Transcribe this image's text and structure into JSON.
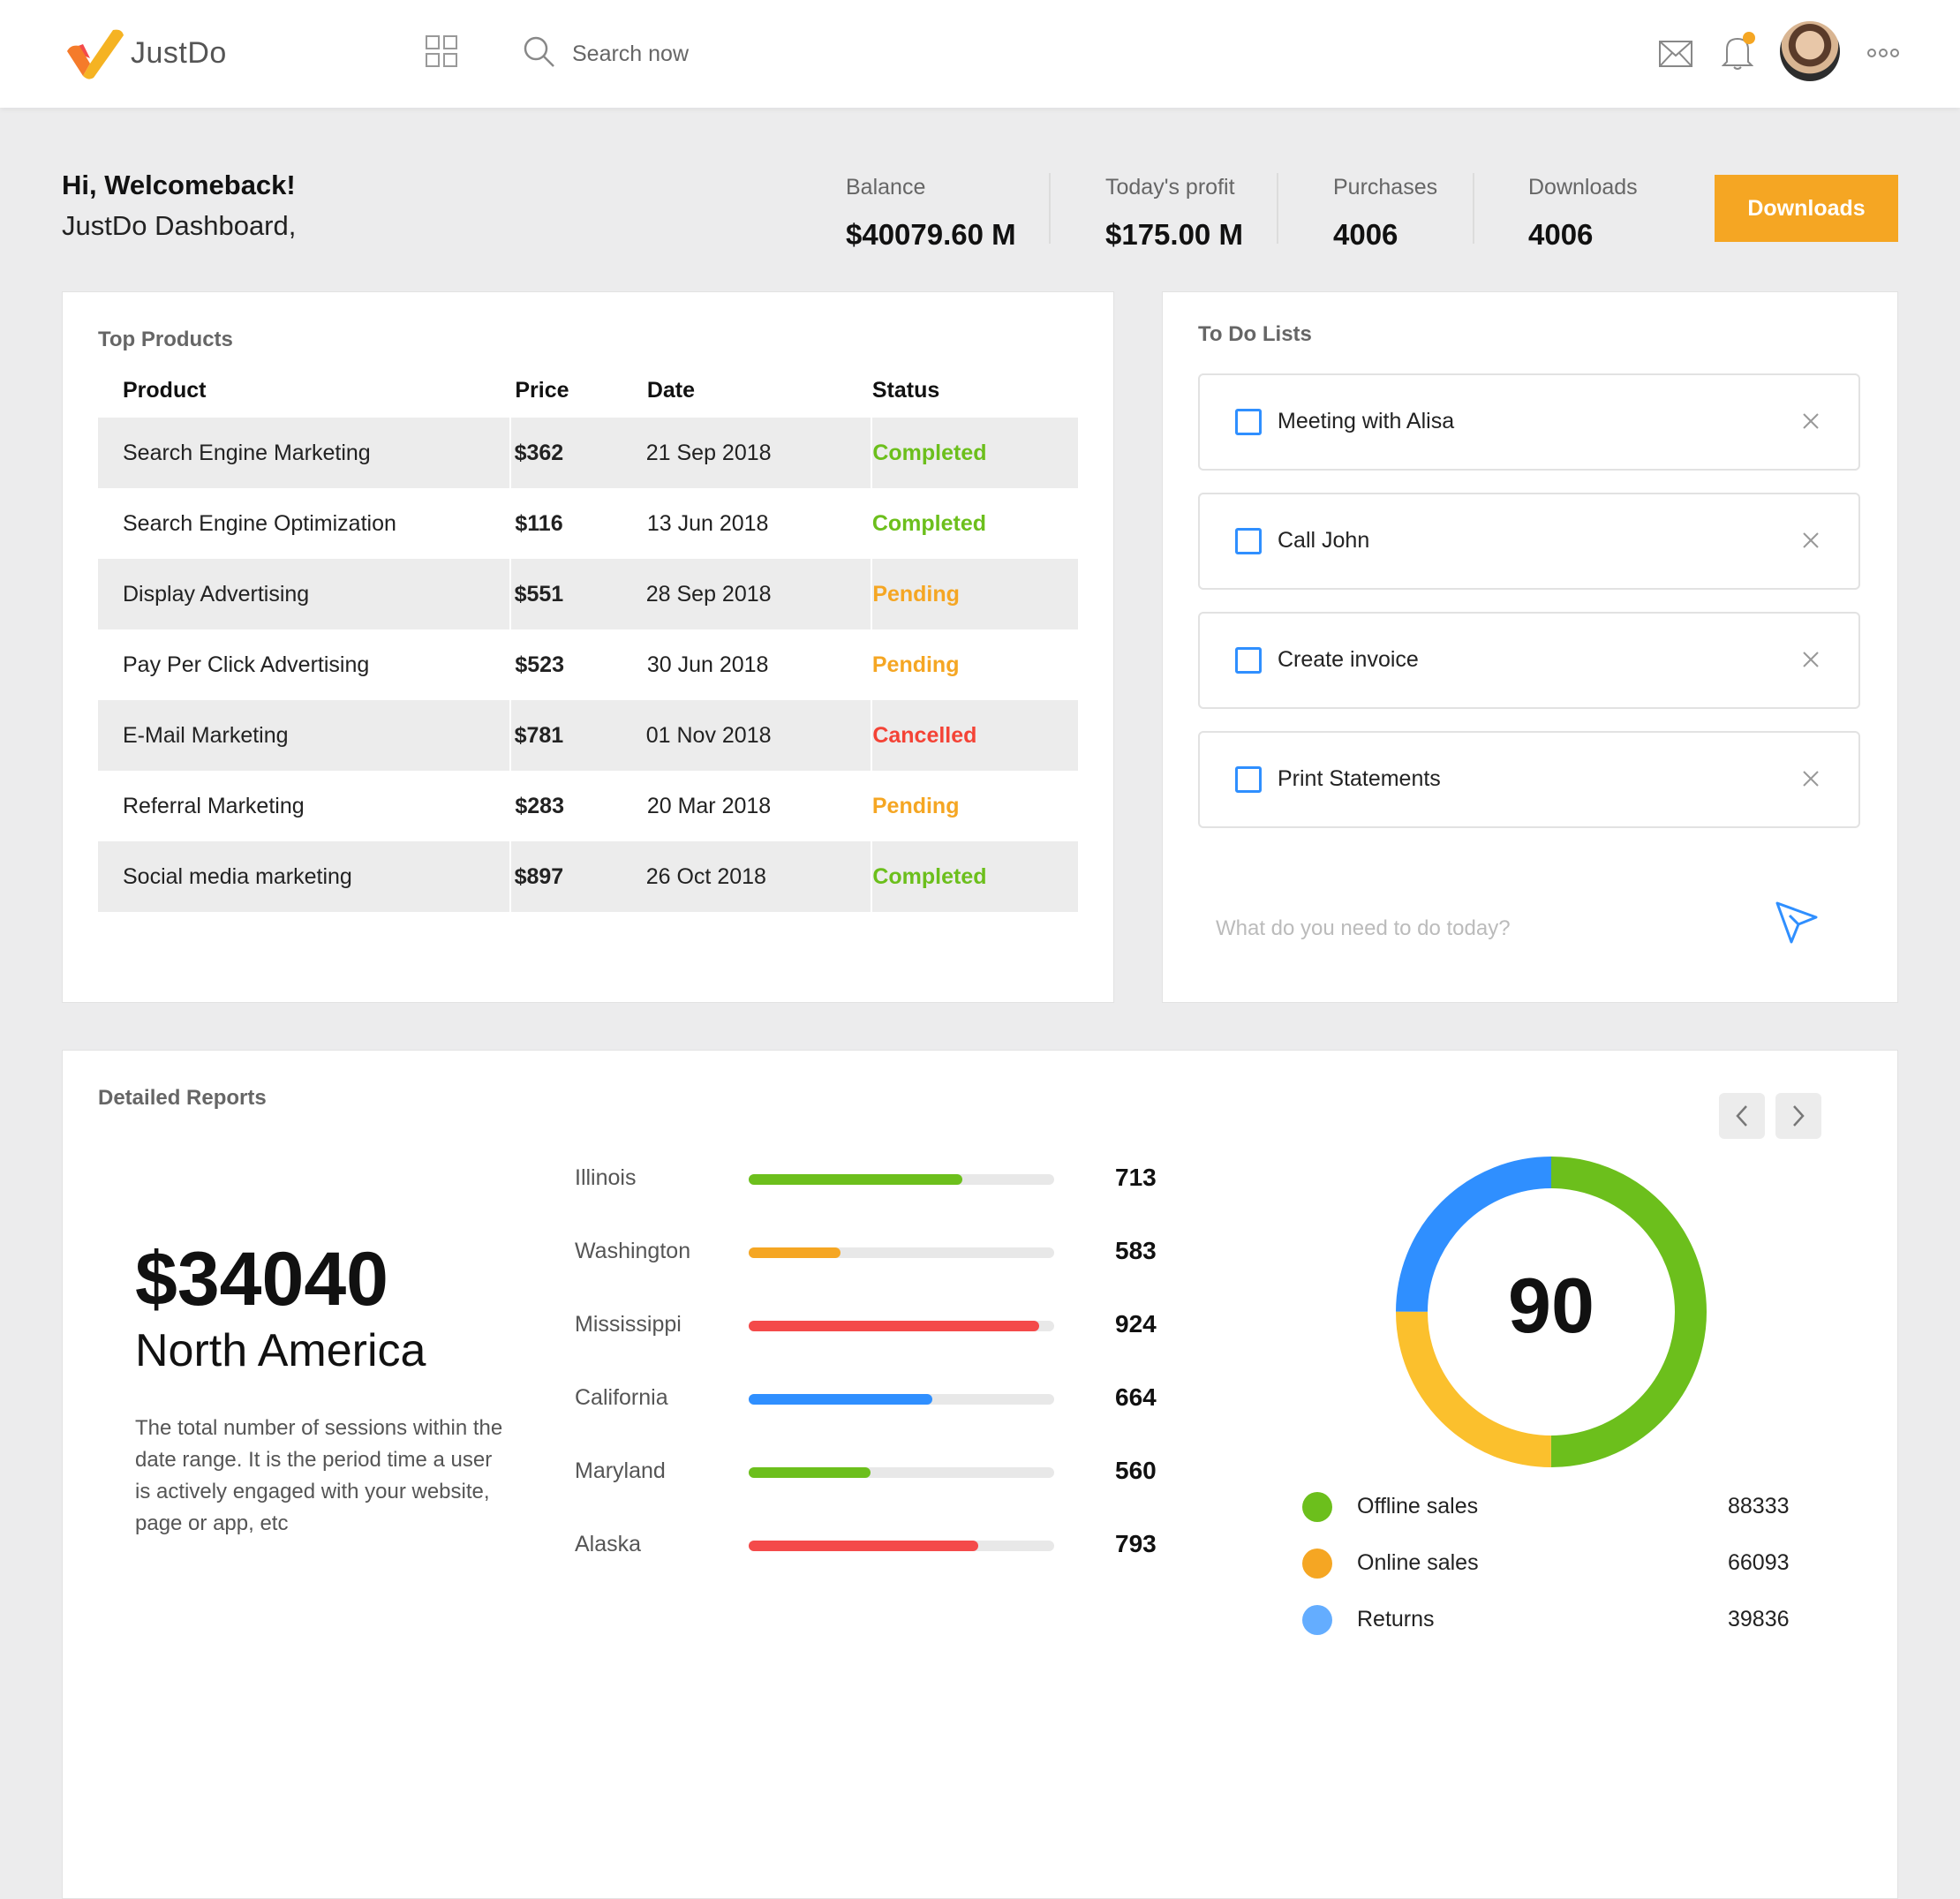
{
  "app": {
    "name": "JustDo"
  },
  "search": {
    "placeholder": "Search now"
  },
  "welcome": {
    "greeting": "Hi, Welcomeback!",
    "subtitle": "JustDo Dashboard,"
  },
  "stats": [
    {
      "label": "Balance",
      "value": "$40079.60 M"
    },
    {
      "label": "Today's profit",
      "value": "$175.00 M"
    },
    {
      "label": "Purchases",
      "value": "4006"
    },
    {
      "label": "Downloads",
      "value": "4006"
    }
  ],
  "downloads_button": {
    "label": "Downloads",
    "color": "#f5a623"
  },
  "top_products": {
    "title": "Top Products",
    "columns": [
      "Product",
      "Price",
      "Date",
      "Status"
    ],
    "rows": [
      {
        "product": "Search Engine Marketing",
        "price": "$362",
        "date": "21 Sep 2018",
        "status": "Completed"
      },
      {
        "product": "Search Engine Optimization",
        "price": "$116",
        "date": "13 Jun 2018",
        "status": "Completed"
      },
      {
        "product": "Display Advertising",
        "price": "$551",
        "date": "28 Sep 2018",
        "status": "Pending"
      },
      {
        "product": "Pay Per Click Advertising",
        "price": "$523",
        "date": "30 Jun 2018",
        "status": "Pending"
      },
      {
        "product": "E-Mail Marketing",
        "price": "$781",
        "date": "01 Nov 2018",
        "status": "Cancelled"
      },
      {
        "product": "Referral Marketing",
        "price": "$283",
        "date": "20 Mar 2018",
        "status": "Pending"
      },
      {
        "product": "Social media marketing",
        "price": "$897",
        "date": "26 Oct 2018",
        "status": "Completed"
      }
    ],
    "status_colors": {
      "Completed": "#6cbf1c",
      "Pending": "#f5a623",
      "Cancelled": "#f44336"
    }
  },
  "todo": {
    "title": "To Do Lists",
    "items": [
      {
        "label": "Meeting with Alisa",
        "checked": false
      },
      {
        "label": "Call John",
        "checked": false
      },
      {
        "label": "Create invoice",
        "checked": false
      },
      {
        "label": "Print Statements",
        "checked": false
      }
    ],
    "input_placeholder": "What do you need to do today?"
  },
  "reports": {
    "title": "Detailed Reports",
    "amount": "$34040",
    "region": "North America",
    "description": "The total number of sessions within the date range. It is the period time a user is actively engaged with your website, page or app, etc",
    "states": [
      {
        "name": "Illinois",
        "value": "713",
        "fill": 0.7,
        "color": "#6cbf1c"
      },
      {
        "name": "Washington",
        "value": "583",
        "fill": 0.3,
        "color": "#f5a623"
      },
      {
        "name": "Mississippi",
        "value": "924",
        "fill": 0.95,
        "color": "#f44a4a"
      },
      {
        "name": "California",
        "value": "664",
        "fill": 0.6,
        "color": "#2f8fff"
      },
      {
        "name": "Maryland",
        "value": "560",
        "fill": 0.4,
        "color": "#6cbf1c"
      },
      {
        "name": "Alaska",
        "value": "793",
        "fill": 0.75,
        "color": "#f44a4a"
      }
    ],
    "donut_value": "90",
    "donut_segments": [
      {
        "fraction": 0.5,
        "color": "#6cbf1c"
      },
      {
        "fraction": 0.25,
        "color": "#fbc02d"
      },
      {
        "fraction": 0.25,
        "color": "#2f8fff"
      }
    ],
    "legend": [
      {
        "label": "Offline sales",
        "value": "88333",
        "color": "#6cbf1c"
      },
      {
        "label": "Online sales",
        "value": "66093",
        "color": "#f5a623"
      },
      {
        "label": "Returns",
        "value": "39836",
        "color": "#64adff"
      }
    ]
  }
}
